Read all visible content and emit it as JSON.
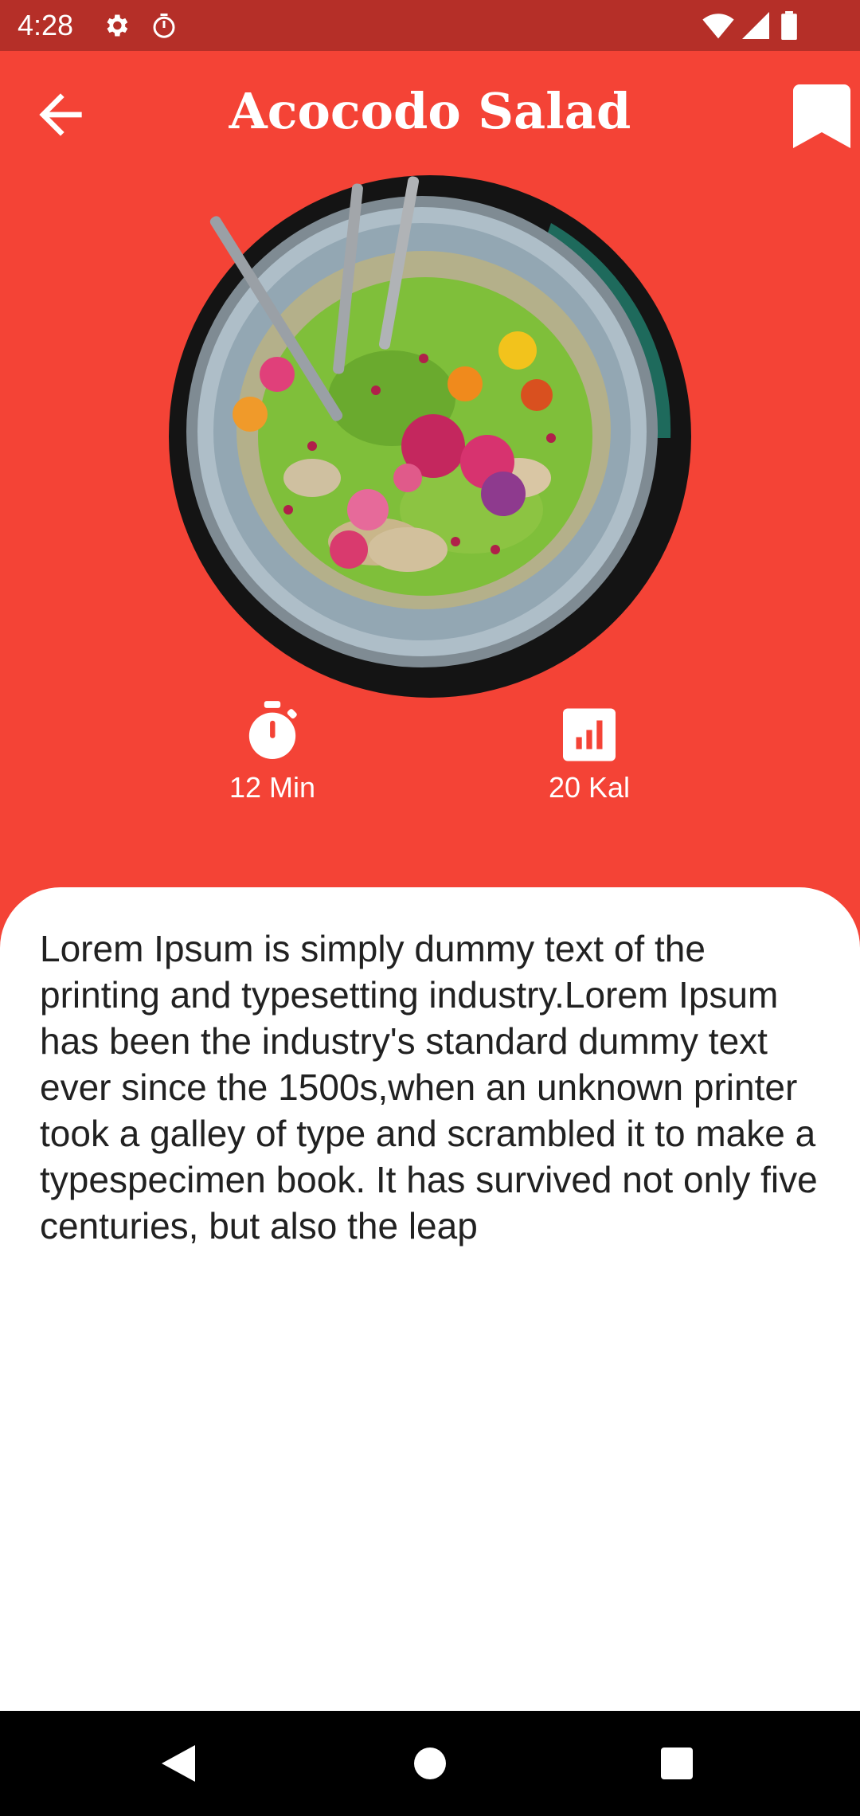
{
  "status_bar": {
    "time": "4:28",
    "left_icons": [
      "settings-icon",
      "timer-icon"
    ],
    "right_icons": [
      "wifi-icon",
      "signal-icon",
      "battery-icon"
    ]
  },
  "header": {
    "title": "Acocodo Salad",
    "back_icon": "arrow-back-icon",
    "bookmark_icon": "bookmark-icon"
  },
  "recipe": {
    "image_alt": "Bowl of avocado salad with flowers",
    "stats": [
      {
        "icon": "timer-icon",
        "label": "12 Min"
      },
      {
        "icon": "bar-chart-icon",
        "label": "20 Kal"
      }
    ],
    "description": "Lorem Ipsum is simply dummy text of the printing and typesetting industry.Lorem Ipsum has been the industry's standard dummy text ever since the 1500s,when an unknown printer took a galley of type and scrambled it to make a typespecimen book. It has survived not only five centuries, but also the leap"
  },
  "nav_bar": {
    "buttons": [
      "back-triangle-icon",
      "home-circle-icon",
      "recents-square-icon"
    ]
  },
  "colors": {
    "primary": "#F44336",
    "status_bar": "#B52F28",
    "card": "#FFFFFF",
    "text": "#212121"
  }
}
